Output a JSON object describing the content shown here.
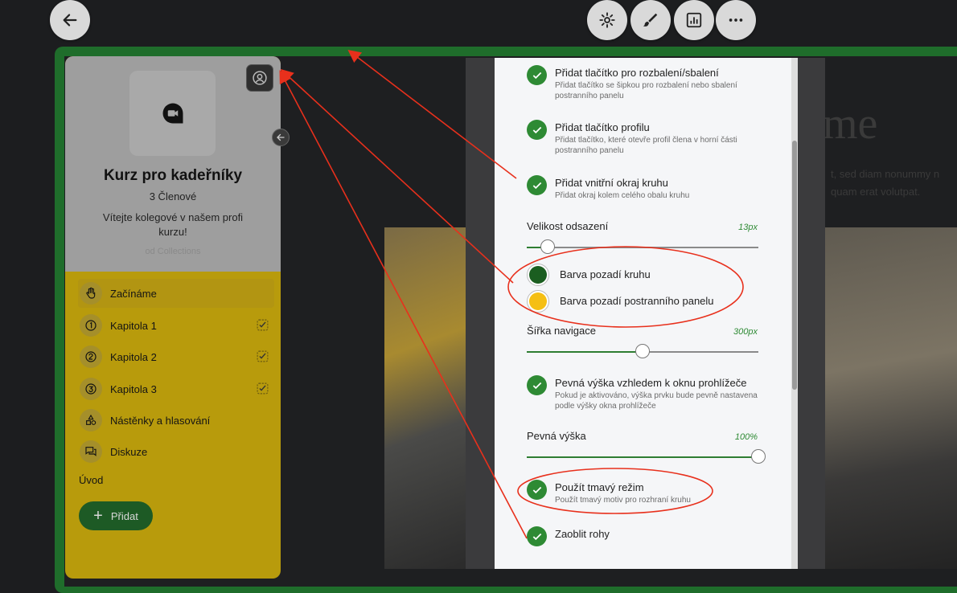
{
  "toolbar": {
    "back_icon": "arrow-left-icon",
    "buttons": [
      "gear-icon",
      "brush-icon",
      "chart-icon",
      "more-horizontal-icon"
    ]
  },
  "sidebar": {
    "course_title": "Kurz pro kadeřníky",
    "members": "3 Členové",
    "welcome": "Vítejte kolegové v našem profi kurzu!",
    "powered_by": "od Collections",
    "menu": [
      {
        "label": "Začínáme",
        "icon": "hand-icon",
        "active": true,
        "checked": false
      },
      {
        "label": "Kapitola 1",
        "icon": "number-1-icon",
        "active": false,
        "checked": true
      },
      {
        "label": "Kapitola 2",
        "icon": "number-2-icon",
        "active": false,
        "checked": true
      },
      {
        "label": "Kapitola 3",
        "icon": "number-3-icon",
        "active": false,
        "checked": true
      },
      {
        "label": "Nástěnky a hlasování",
        "icon": "shapes-icon",
        "active": false,
        "checked": false
      },
      {
        "label": "Diskuze",
        "icon": "chat-icon",
        "active": false,
        "checked": false
      }
    ],
    "section": "Úvod",
    "add_label": "Přidat"
  },
  "background": {
    "heading": "me",
    "text_line1": "t, sed diam nonummy n",
    "text_line2": "quam erat volutpat."
  },
  "settings": {
    "opt_collapse_title": "Přidat tlačítko pro rozbalení/sbalení",
    "opt_collapse_desc": "Přidat tlačítko se šipkou pro rozbalení nebo sbalení postranního panelu",
    "opt_profile_title": "Přidat tlačítko profilu",
    "opt_profile_desc": "Přidat tlačítko, které otevře profil člena v horní části postranního panelu",
    "opt_border_title": "Přidat vnitřní okraj kruhu",
    "opt_border_desc": "Přidat okraj kolem celého obalu kruhu",
    "padding_label": "Velikost odsazení",
    "padding_value": "13px",
    "padding_level": 0.09,
    "circle_bg_label": "Barva pozadí kruhu",
    "circle_bg_color": "#1b5e20",
    "sidebar_bg_label": "Barva pozadí postranního panelu",
    "sidebar_bg_color": "#f5bf14",
    "nav_width_label": "Šířka navigace",
    "nav_width_value": "300px",
    "nav_width_level": 0.5,
    "opt_fixed_title": "Pevná výška vzhledem k oknu prohlížeče",
    "opt_fixed_desc": "Pokud je aktivováno, výška prvku bude pevně nastavena podle výšky okna prohlížeče",
    "fixed_height_label": "Pevná výška",
    "fixed_height_value": "100%",
    "fixed_height_level": 1.0,
    "opt_dark_title": "Použít tmavý režim",
    "opt_dark_desc": "Použít tmavý motiv pro rozhraní kruhu",
    "opt_round_title": "Zaoblit rohy"
  },
  "colors": {
    "accent_green": "#2e8a34",
    "annotation_red": "#e8301c",
    "frame_green": "#1f6d2b"
  }
}
